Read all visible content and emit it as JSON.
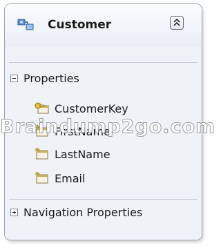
{
  "entity": {
    "title": "Customer",
    "icon": "entity-type-icon",
    "collapse_icon": "double-chevron-up-icon"
  },
  "properties_section": {
    "label": "Properties",
    "expander": "minus",
    "items": [
      {
        "name": "CustomerKey",
        "icon": "key-property-icon"
      },
      {
        "name": "FirstName",
        "icon": "property-icon"
      },
      {
        "name": "LastName",
        "icon": "property-icon"
      },
      {
        "name": "Email",
        "icon": "property-icon"
      }
    ]
  },
  "navigation_section": {
    "label": "Navigation Properties",
    "expander": "plus"
  },
  "watermark": "Braindump2go.com"
}
